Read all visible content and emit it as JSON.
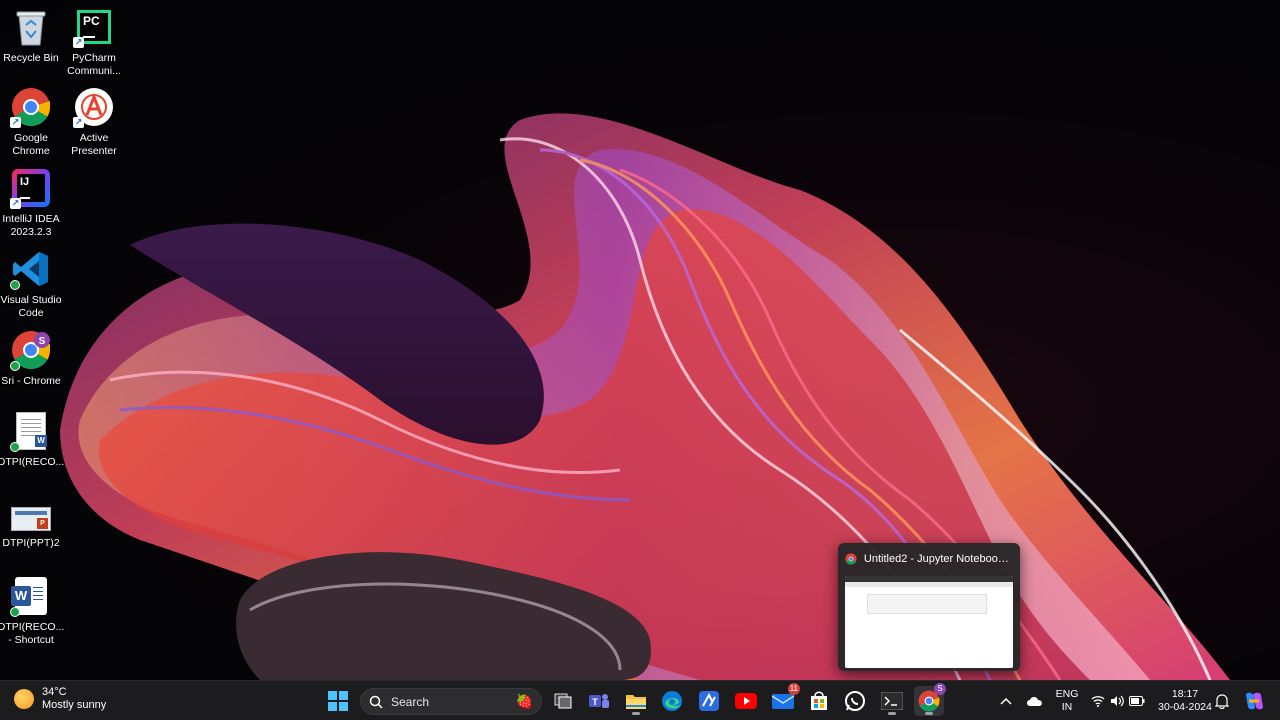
{
  "desktop": {
    "icons": [
      {
        "label": "Recycle Bin"
      },
      {
        "label": "PyCharm Communi..."
      },
      {
        "label": "Google Chrome"
      },
      {
        "label": "Active Presenter"
      },
      {
        "label": "IntelliJ IDEA 2023.2.3"
      },
      {
        "label": "Visual Studio Code"
      },
      {
        "label": "Sri - Chrome"
      },
      {
        "label": "DTPI(RECO..."
      },
      {
        "label": "DTPI(PPT)2"
      },
      {
        "label": "DTPI(RECO... - Shortcut"
      }
    ]
  },
  "preview": {
    "title": "Untitled2 - Jupyter Notebook - ..."
  },
  "taskbar": {
    "weather": {
      "temp": "34°C",
      "condition": "Mostly sunny"
    },
    "search": {
      "label": "Search"
    },
    "mail_badge": "11",
    "chrome_profile": "S",
    "tray": {
      "lang_top": "ENG",
      "lang_bottom": "IN",
      "time": "18:17",
      "date": "30-04-2024"
    }
  }
}
